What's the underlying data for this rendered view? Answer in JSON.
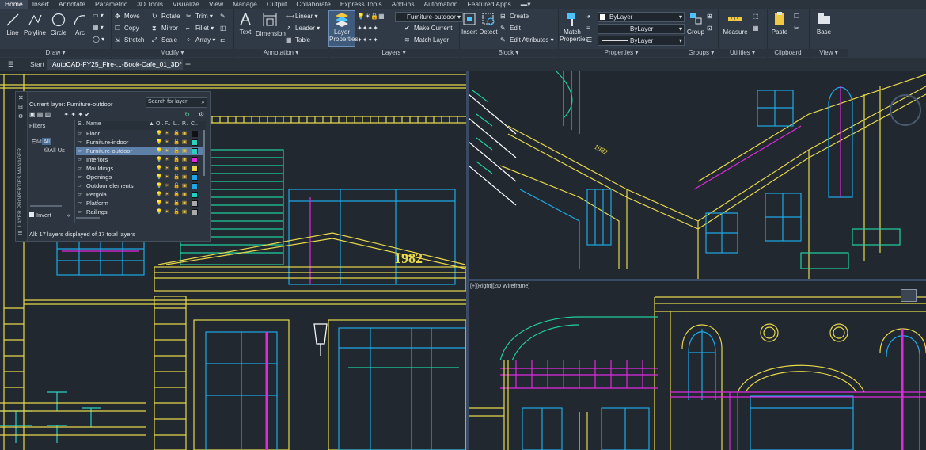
{
  "menu_tabs": [
    "Home",
    "Insert",
    "Annotate",
    "Parametric",
    "3D Tools",
    "Visualize",
    "View",
    "Manage",
    "Output",
    "Collaborate",
    "Express Tools",
    "Add-ins",
    "Automation",
    "Featured Apps"
  ],
  "ribbon": {
    "draw": {
      "title": "Draw ▾",
      "tools": [
        "Line",
        "Polyline",
        "Circle",
        "Arc"
      ]
    },
    "modify": {
      "title": "Modify ▾",
      "rows": [
        [
          "Move",
          "Rotate",
          "Trim ▾"
        ],
        [
          "Copy",
          "Mirror",
          "Fillet ▾"
        ],
        [
          "Stretch",
          "Scale",
          "Array ▾"
        ]
      ]
    },
    "annotation": {
      "title": "Annotation ▾",
      "text": "Text",
      "dimension": "Dimension",
      "linear": "Linear ▾",
      "leader": "Leader ▾",
      "table": "Table"
    },
    "layers": {
      "title": "Layers ▾",
      "layer_properties_1": "Layer",
      "layer_properties_2": "Properties",
      "current_layer": "Furniture-outdoor",
      "make_current": "Make Current",
      "match_layer": "Match Layer"
    },
    "block": {
      "title": "Block ▾",
      "insert": "Insert",
      "detect": "Detect",
      "create": "Create",
      "edit": "Edit",
      "edit_attributes": "Edit Attributes ▾"
    },
    "properties": {
      "title": "Properties ▾",
      "match_1": "Match",
      "match_2": "Properties",
      "color": "ByLayer",
      "linetype": "ByLayer",
      "lineweight": "ByLayer"
    },
    "groups": {
      "title": "Groups ▾",
      "group": "Group"
    },
    "utilities": {
      "title": "Utilities ▾",
      "measure": "Measure"
    },
    "clipboard": {
      "title": "Clipboard",
      "paste": "Paste"
    },
    "view": {
      "title": "View ▾",
      "base": "Base"
    }
  },
  "doc_tabs": {
    "start": "Start",
    "active": "AutoCAD-FY25_Fire-...-Book-Cafe_01_3D*",
    "close": "×",
    "add": "+"
  },
  "viewport_label": "[+][Right][2D Wireframe]",
  "building_year": "1982",
  "layer_manager": {
    "side_title": "LAYER PROPERTIES MANAGER",
    "current_layer_label": "Current layer: Furniture-outdoor",
    "search_placeholder": "Search for layer",
    "filters_label": "Filters",
    "tree_all": "All",
    "tree_all_used": "All Us",
    "invert_label": "Invert",
    "col_status": "S..",
    "col_name": "Name",
    "col_on": "O..",
    "col_freeze": "F..",
    "col_lock": "L..",
    "col_plot": "P..",
    "col_color": "C..",
    "layers": [
      {
        "name": "Floor",
        "color": "#111111"
      },
      {
        "name": "Furniture-indoor",
        "color": "#2ad1c1"
      },
      {
        "name": "Furniture-outdoor",
        "color": "#2ad1c1"
      },
      {
        "name": "Interiors",
        "color": "#e02ae0"
      },
      {
        "name": "Mouldings",
        "color": "#e8d84a"
      },
      {
        "name": "Openings",
        "color": "#1ea9e6"
      },
      {
        "name": "Outdoor elements",
        "color": "#1ea9e6"
      },
      {
        "name": "Pergola",
        "color": "#1fd0c0"
      },
      {
        "name": "Platform",
        "color": "#aaaaaa"
      },
      {
        "name": "Railings",
        "color": "#aaaaaa"
      }
    ],
    "status_text": "All: 17 layers displayed of 17 total layers"
  },
  "colors": {
    "yellow": "#e8d84a",
    "cyan": "#1ea9e6",
    "magenta": "#e02ae0",
    "teal": "#1fd0a0",
    "bg": "#212830"
  }
}
